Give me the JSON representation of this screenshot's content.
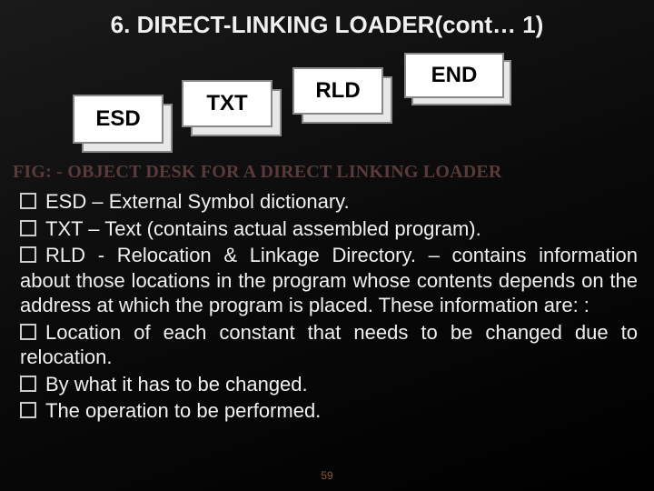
{
  "title": "6. DIRECT-LINKING LOADER(cont… 1)",
  "boxes": {
    "esd": "ESD",
    "txt": "TXT",
    "rld": "RLD",
    "end": "END"
  },
  "fig_caption": "FIG: - OBJECT DESK FOR A DIRECT LINKING LOADER",
  "bullets": [
    "ESD – External Symbol dictionary.",
    "TXT – Text (contains actual assembled program).",
    "RLD  - Relocation & Linkage Directory. – contains information about those locations in the program whose contents depends on the address at which the program is placed. These information are: :",
    "Location of each constant that needs to be changed due to relocation.",
    "By what it has to be changed.",
    "The operation to be performed."
  ],
  "page_number": "59"
}
